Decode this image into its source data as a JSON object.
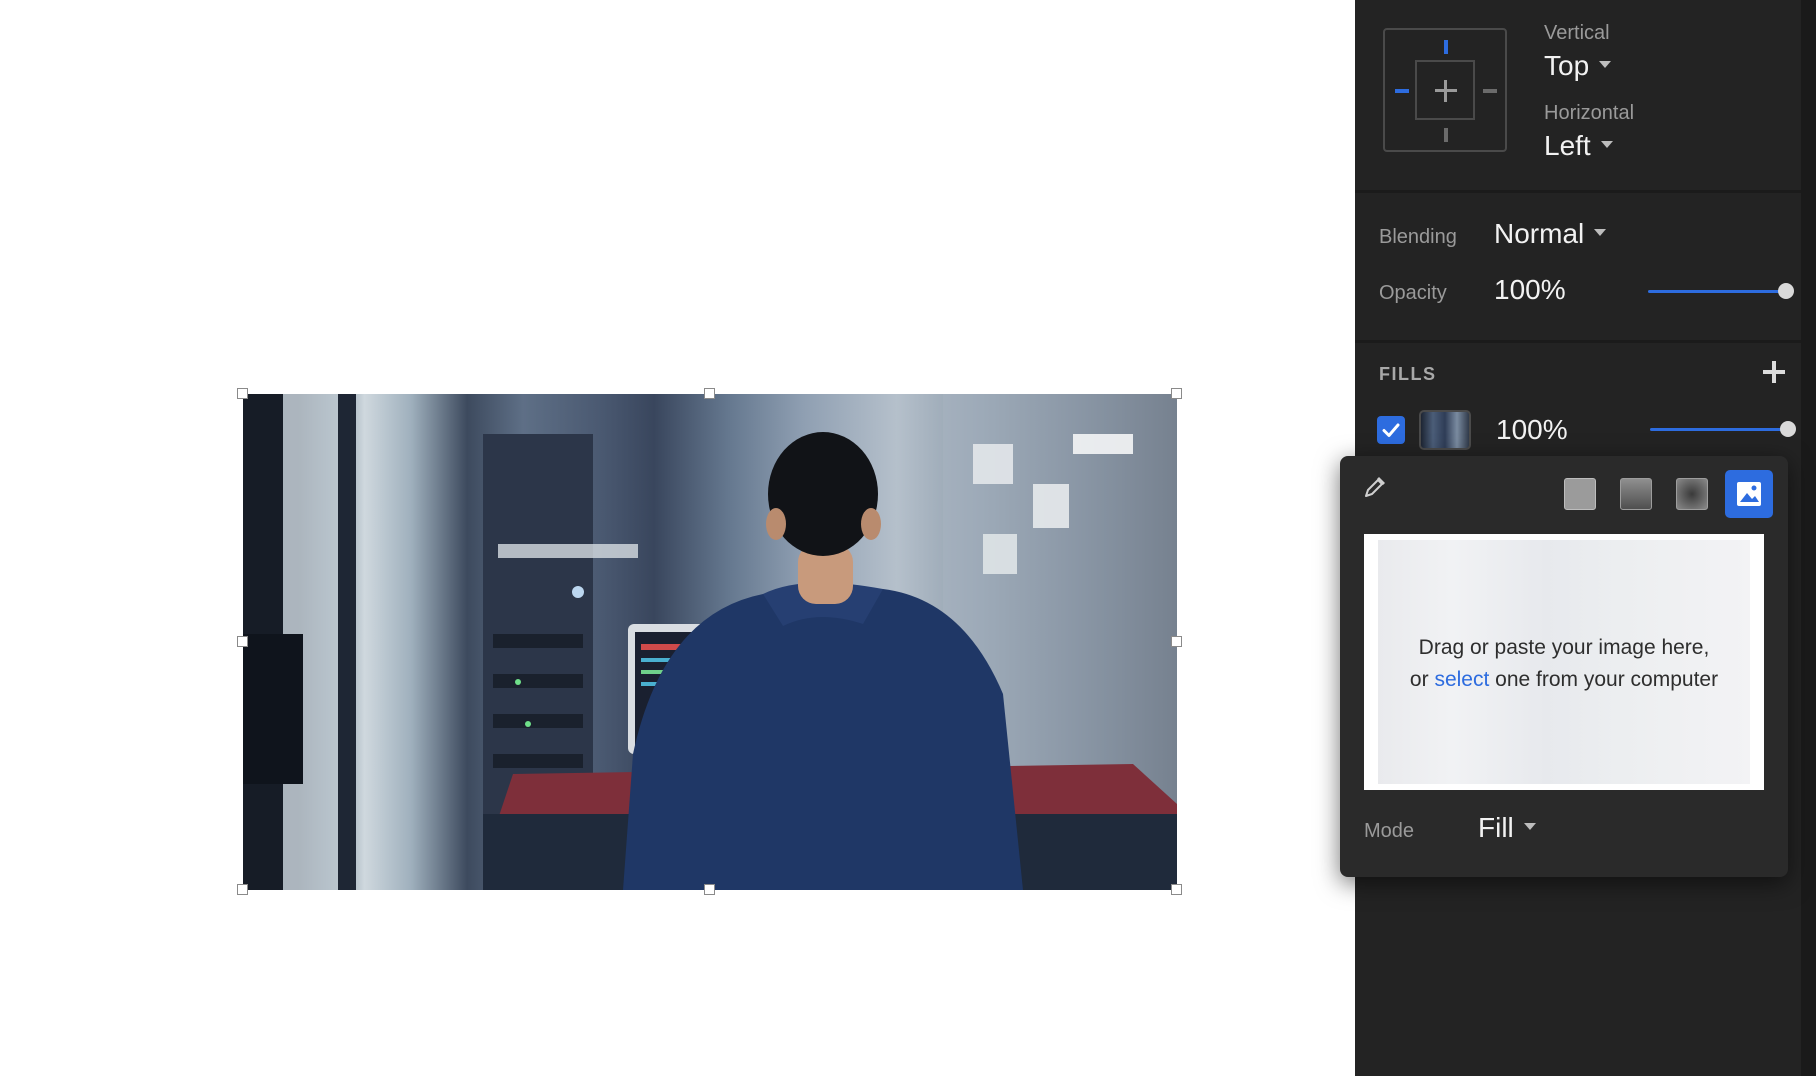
{
  "alignment": {
    "vertical_label": "Vertical",
    "vertical_value": "Top",
    "horizontal_label": "Horizontal",
    "horizontal_value": "Left"
  },
  "layer": {
    "blending_label": "Blending",
    "blending_value": "Normal",
    "opacity_label": "Opacity",
    "opacity_value": "100%",
    "opacity_fraction": 1.0
  },
  "fills": {
    "title": "FILLS",
    "items": [
      {
        "enabled": true,
        "opacity_value": "100%",
        "opacity_fraction": 1.0
      }
    ]
  },
  "fill_popover": {
    "fill_types": [
      "solid-fill",
      "linear-gradient",
      "radial-gradient",
      "image-fill"
    ],
    "active_type": "image-fill",
    "drop_line1": "Drag or paste your image here,",
    "drop_or": "or",
    "drop_link": "select",
    "drop_rest": "one from your computer",
    "mode_label": "Mode",
    "mode_value": "Fill"
  },
  "colors": {
    "accent": "#2d6cdf",
    "panel_bg": "#232323",
    "popover_bg": "#2a2a2a"
  }
}
